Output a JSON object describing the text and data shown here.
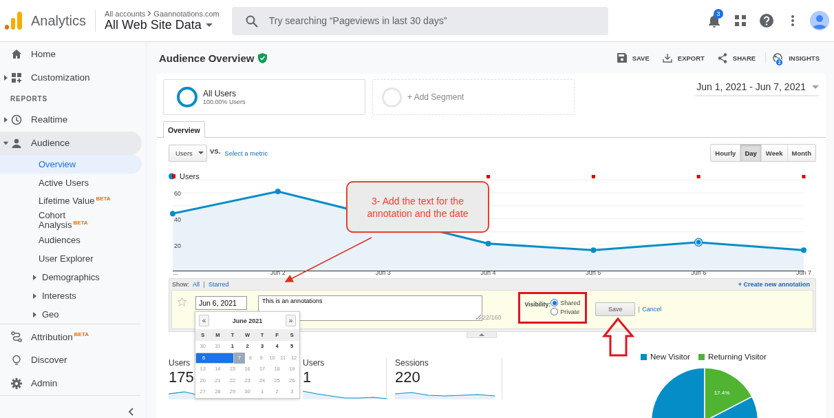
{
  "header": {
    "product": "Analytics",
    "breadcrumb": [
      "All accounts",
      "Gaannotations.com"
    ],
    "view": "All Web Site Data",
    "search": {
      "placeholder": "Try searching “Pageviews in last 30 days”"
    },
    "notifications_badge": "3"
  },
  "sidebar": {
    "sections": [
      {
        "items": [
          {
            "label": "Home",
            "kind": "link",
            "selected": false
          },
          {
            "label": "Customization",
            "kind": "group",
            "expanded": false,
            "selected": false
          }
        ]
      },
      {
        "heading": "REPORTS",
        "items": [
          {
            "label": "Realtime",
            "kind": "group",
            "expanded": false,
            "selected": false
          },
          {
            "label": "Audience",
            "kind": "group",
            "expanded": true,
            "selected": false,
            "children": [
              {
                "label": "Overview",
                "kind": "link",
                "selected": true
              },
              {
                "label": "Active Users",
                "kind": "link",
                "selected": false
              },
              {
                "label": "Lifetime Value",
                "kind": "link",
                "selected": false,
                "badge": "BETA"
              },
              {
                "label": "Cohort Analysis",
                "kind": "link",
                "selected": false,
                "badge": "BETA"
              },
              {
                "label": "Audiences",
                "kind": "link",
                "selected": false
              },
              {
                "label": "User Explorer",
                "kind": "link",
                "selected": false
              },
              {
                "label": "Demographics",
                "kind": "group",
                "expanded": false,
                "selected": false
              },
              {
                "label": "Interests",
                "kind": "group",
                "expanded": false,
                "selected": false
              },
              {
                "label": "Geo",
                "kind": "group",
                "expanded": false,
                "selected": false
              }
            ]
          }
        ]
      },
      {
        "items": [
          {
            "label": "Attribution",
            "kind": "link",
            "selected": false,
            "badge": "BETA"
          },
          {
            "label": "Discover",
            "kind": "link",
            "selected": false
          },
          {
            "label": "Admin",
            "kind": "link",
            "selected": false
          }
        ]
      }
    ]
  },
  "report": {
    "title": "Audience Overview",
    "verified": true,
    "actions": [
      {
        "label": "SAVE"
      },
      {
        "label": "EXPORT"
      },
      {
        "label": "SHARE"
      },
      {
        "label": "INSIGHTS",
        "badge": "2"
      }
    ],
    "segments": [
      {
        "kind": "segment",
        "name": "All Users",
        "detail": "100.00% Users"
      },
      {
        "kind": "add",
        "name": "+ Add Segment"
      }
    ],
    "date_range": "Jun 1, 2021 - Jun 7, 2021",
    "tabs": [
      {
        "label": "Overview",
        "selected": true
      }
    ],
    "metric_select": "Users",
    "vs": "VS.",
    "compare_link": "Select a metric",
    "granularity": [
      {
        "label": "Hourly",
        "selected": false
      },
      {
        "label": "Day",
        "selected": true
      },
      {
        "label": "Week",
        "selected": false
      },
      {
        "label": "Month",
        "selected": false
      }
    ],
    "chart": {
      "annotation_flags": [
        false,
        false,
        false,
        true,
        true,
        true,
        true
      ],
      "hovered": [
        false,
        false,
        false,
        false,
        false,
        true,
        false
      ],
      "chart_data": {
        "type": "area",
        "grid": true,
        "categories": [
          "...",
          "Jun 2",
          "Jun 3",
          "Jun 4",
          "Jun 5",
          "Jun 6",
          "Jun 7"
        ],
        "series": [
          {
            "name": "Users",
            "color": "#058dc7",
            "marker": "circle",
            "values": [
              44,
              61,
              null,
              21,
              16,
              22,
              16
            ]
          }
        ],
        "ylim": [
          0,
          70
        ],
        "yticks": [
          20,
          40,
          60
        ]
      }
    },
    "annotations_panel": {
      "show_label": "Show:",
      "filters": [
        "All",
        "Starred"
      ],
      "create_link": "+ Create new annotation",
      "form": {
        "starred": false,
        "date": "Jun 6, 2021",
        "text": "This is an annotations",
        "counter": "22/160",
        "visibility_label": "Visibility:",
        "options": [
          {
            "label": "Shared",
            "selected": true
          },
          {
            "label": "Private",
            "selected": false
          }
        ],
        "save": "Save",
        "cancel": "Cancel"
      },
      "calendar": {
        "prev": "«",
        "next": "»",
        "month": "June 2021",
        "weekdays": [
          "S",
          "M",
          "T",
          "W",
          "T",
          "F",
          "S"
        ],
        "weeks": [
          [
            {
              "day": "30",
              "disabled": true,
              "selected": false,
              "today": false
            },
            {
              "day": "31",
              "disabled": true,
              "selected": false,
              "today": false
            },
            {
              "day": "1",
              "disabled": false,
              "selected": false,
              "today": false
            },
            {
              "day": "2",
              "disabled": false,
              "selected": false,
              "today": false
            },
            {
              "day": "3",
              "disabled": false,
              "selected": false,
              "today": false
            },
            {
              "day": "4",
              "disabled": false,
              "selected": false,
              "today": false
            },
            {
              "day": "5",
              "disabled": false,
              "selected": false,
              "today": false
            }
          ],
          [
            {
              "day": "6",
              "disabled": false,
              "selected": true,
              "today": false
            },
            {
              "day": "7",
              "disabled": false,
              "selected": false,
              "today": true
            },
            {
              "day": "8",
              "disabled": true,
              "selected": false,
              "today": false
            },
            {
              "day": "9",
              "disabled": true,
              "selected": false,
              "today": false
            },
            {
              "day": "10",
              "disabled": true,
              "selected": false,
              "today": false
            },
            {
              "day": "11",
              "disabled": true,
              "selected": false,
              "today": false
            },
            {
              "day": "12",
              "disabled": true,
              "selected": false,
              "today": false
            }
          ],
          [
            {
              "day": "13",
              "disabled": true,
              "selected": false,
              "today": false
            },
            {
              "day": "14",
              "disabled": true,
              "selected": false,
              "today": false
            },
            {
              "day": "15",
              "disabled": true,
              "selected": false,
              "today": false
            },
            {
              "day": "16",
              "disabled": true,
              "selected": false,
              "today": false
            },
            {
              "day": "17",
              "disabled": true,
              "selected": false,
              "today": false
            },
            {
              "day": "18",
              "disabled": true,
              "selected": false,
              "today": false
            },
            {
              "day": "19",
              "disabled": true,
              "selected": false,
              "today": false
            }
          ],
          [
            {
              "day": "20",
              "disabled": true,
              "selected": false,
              "today": false
            },
            {
              "day": "21",
              "disabled": true,
              "selected": false,
              "today": false
            },
            {
              "day": "22",
              "disabled": true,
              "selected": false,
              "today": false
            },
            {
              "day": "23",
              "disabled": true,
              "selected": false,
              "today": false
            },
            {
              "day": "24",
              "disabled": true,
              "selected": false,
              "today": false
            },
            {
              "day": "25",
              "disabled": true,
              "selected": false,
              "today": false
            },
            {
              "day": "26",
              "disabled": true,
              "selected": false,
              "today": false
            }
          ],
          [
            {
              "day": "27",
              "disabled": true,
              "selected": false,
              "today": false
            },
            {
              "day": "28",
              "disabled": true,
              "selected": false,
              "today": false
            },
            {
              "day": "29",
              "disabled": true,
              "selected": false,
              "today": false
            },
            {
              "day": "30",
              "disabled": true,
              "selected": false,
              "today": false
            },
            {
              "day": "1",
              "disabled": true,
              "selected": false,
              "today": false
            },
            {
              "day": "2",
              "disabled": true,
              "selected": false,
              "today": false
            },
            {
              "day": "3",
              "disabled": true,
              "selected": false,
              "today": false
            }
          ]
        ]
      }
    },
    "metrics": [
      {
        "label": "Users",
        "value": "175"
      },
      {
        "label": "Users",
        "value": "1"
      },
      {
        "label": "Sessions",
        "value": "220"
      }
    ],
    "visitor_chart": {
      "chart_data": {
        "type": "pie",
        "categories": [
          "New Visitor",
          "Returning Visitor"
        ],
        "colors": [
          "#058dc7",
          "#50b432"
        ],
        "series": [
          {
            "values": [
              82.6,
              17.4
            ]
          }
        ],
        "value_labels": [
          null,
          "17.4%"
        ]
      }
    }
  },
  "tutorial_overlay": {
    "callout": "3- Add the text for the annotation and the date"
  }
}
